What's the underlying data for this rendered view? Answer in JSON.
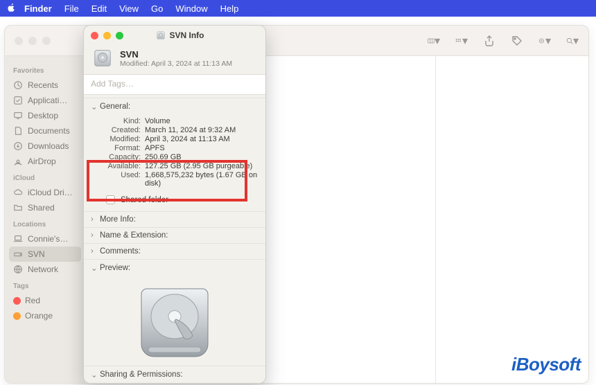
{
  "menubar": {
    "app": "Finder",
    "items": [
      "File",
      "Edit",
      "View",
      "Go",
      "Window",
      "Help"
    ]
  },
  "finder": {
    "sidebar": {
      "favorites_label": "Favorites",
      "favorites": [
        "Recents",
        "Applicati…",
        "Desktop",
        "Documents",
        "Downloads",
        "AirDrop"
      ],
      "icloud_label": "iCloud",
      "icloud": [
        "iCloud Dri…",
        "Shared"
      ],
      "locations_label": "Locations",
      "locations": [
        "Connie's…",
        "SVN",
        "Network"
      ],
      "tags_label": "Tags",
      "tags": [
        {
          "label": "Red",
          "color": "#ff5b55"
        },
        {
          "label": "Orange",
          "color": "#ff9f37"
        }
      ]
    }
  },
  "info": {
    "title": "SVN Info",
    "header": {
      "name": "SVN",
      "modified_line": "Modified: April 3, 2024 at 11:13 AM"
    },
    "tags_placeholder": "Add Tags…",
    "sections": {
      "general_label": "General:",
      "more_info_label": "More Info:",
      "name_ext_label": "Name & Extension:",
      "comments_label": "Comments:",
      "preview_label": "Preview:",
      "sharing_label": "Sharing & Permissions:"
    },
    "general": {
      "kind_k": "Kind:",
      "kind_v": "Volume",
      "created_k": "Created:",
      "created_v": "March 11, 2024 at 9:32 AM",
      "modified_k": "Modified:",
      "modified_v": "April 3, 2024 at 11:13 AM",
      "format_k": "Format:",
      "format_v": "APFS",
      "capacity_k": "Capacity:",
      "capacity_v": "250.69 GB",
      "available_k": "Available:",
      "available_v": "127.25 GB (2.95 GB purgeable)",
      "used_k": "Used:",
      "used_v": "1,668,575,232 bytes (1.67 GB on disk)"
    },
    "shared_label": "Shared folder"
  },
  "watermark": "iBoysoft"
}
